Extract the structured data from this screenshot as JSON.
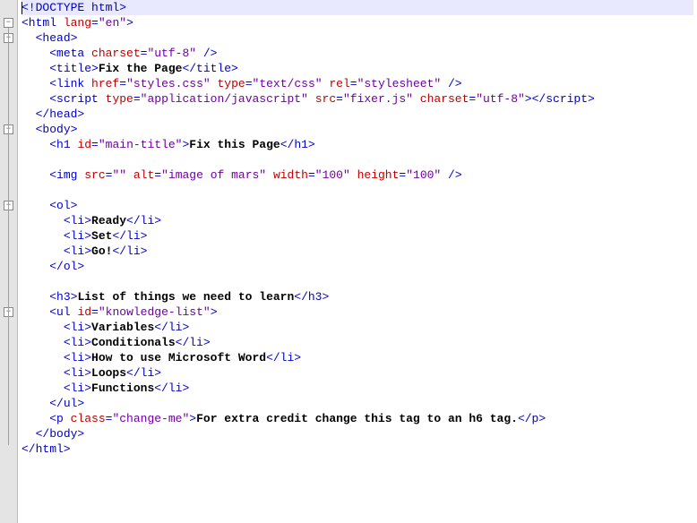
{
  "lines": [
    {
      "indent": 0,
      "fold": false,
      "hl": true,
      "caret": "start",
      "tokens": [
        {
          "t": "tag",
          "v": "<!DOCTYPE html>"
        }
      ]
    },
    {
      "indent": 0,
      "fold": true,
      "tokens": [
        {
          "t": "tag",
          "v": "<html "
        },
        {
          "t": "attr",
          "v": "lang"
        },
        {
          "t": "tag",
          "v": "="
        },
        {
          "t": "val",
          "v": "\"en\""
        },
        {
          "t": "tag",
          "v": ">"
        }
      ]
    },
    {
      "indent": 1,
      "fold": true,
      "tokens": [
        {
          "t": "tag",
          "v": "<head>"
        }
      ]
    },
    {
      "indent": 2,
      "fold": false,
      "tokens": [
        {
          "t": "tag",
          "v": "<meta "
        },
        {
          "t": "attr",
          "v": "charset"
        },
        {
          "t": "tag",
          "v": "="
        },
        {
          "t": "val",
          "v": "\"utf-8\""
        },
        {
          "t": "tag",
          "v": " />"
        }
      ]
    },
    {
      "indent": 2,
      "fold": false,
      "tokens": [
        {
          "t": "tag",
          "v": "<title>"
        },
        {
          "t": "txt",
          "v": "Fix the Page"
        },
        {
          "t": "tag",
          "v": "</title>"
        }
      ]
    },
    {
      "indent": 2,
      "fold": false,
      "tokens": [
        {
          "t": "tag",
          "v": "<link "
        },
        {
          "t": "attr",
          "v": "href"
        },
        {
          "t": "tag",
          "v": "="
        },
        {
          "t": "val",
          "v": "\"styles.css\""
        },
        {
          "t": "tag",
          "v": " "
        },
        {
          "t": "attr",
          "v": "type"
        },
        {
          "t": "tag",
          "v": "="
        },
        {
          "t": "val",
          "v": "\"text/css\""
        },
        {
          "t": "tag",
          "v": " "
        },
        {
          "t": "attr",
          "v": "rel"
        },
        {
          "t": "tag",
          "v": "="
        },
        {
          "t": "val",
          "v": "\"stylesheet\""
        },
        {
          "t": "tag",
          "v": " />"
        }
      ]
    },
    {
      "indent": 2,
      "fold": false,
      "tokens": [
        {
          "t": "tag",
          "v": "<script "
        },
        {
          "t": "attr",
          "v": "type"
        },
        {
          "t": "tag",
          "v": "="
        },
        {
          "t": "val",
          "v": "\"application/javascript\""
        },
        {
          "t": "tag",
          "v": " "
        },
        {
          "t": "attr",
          "v": "src"
        },
        {
          "t": "tag",
          "v": "="
        },
        {
          "t": "val",
          "v": "\"fixer.js\""
        },
        {
          "t": "tag",
          "v": " "
        },
        {
          "t": "attr",
          "v": "charset"
        },
        {
          "t": "tag",
          "v": "="
        },
        {
          "t": "val",
          "v": "\"utf-8\""
        },
        {
          "t": "tag",
          "v": ">"
        },
        {
          "t": "tag",
          "v": "</script>"
        }
      ]
    },
    {
      "indent": 1,
      "fold": false,
      "tokens": [
        {
          "t": "tag",
          "v": "</head>"
        }
      ]
    },
    {
      "indent": 1,
      "fold": true,
      "tokens": [
        {
          "t": "tag",
          "v": "<body>"
        }
      ]
    },
    {
      "indent": 2,
      "fold": false,
      "tokens": [
        {
          "t": "tag",
          "v": "<h1 "
        },
        {
          "t": "attr",
          "v": "id"
        },
        {
          "t": "tag",
          "v": "="
        },
        {
          "t": "val",
          "v": "\"main-title\""
        },
        {
          "t": "tag",
          "v": ">"
        },
        {
          "t": "txt",
          "v": "Fix this Page"
        },
        {
          "t": "tag",
          "v": "</h1>"
        }
      ]
    },
    {
      "indent": 0,
      "fold": false,
      "blank": true,
      "tokens": []
    },
    {
      "indent": 2,
      "fold": false,
      "tokens": [
        {
          "t": "tag",
          "v": "<img "
        },
        {
          "t": "attr",
          "v": "src"
        },
        {
          "t": "tag",
          "v": "="
        },
        {
          "t": "val",
          "v": "\"\""
        },
        {
          "t": "tag",
          "v": " "
        },
        {
          "t": "attr",
          "v": "alt"
        },
        {
          "t": "tag",
          "v": "="
        },
        {
          "t": "val",
          "v": "\"image of mars\""
        },
        {
          "t": "tag",
          "v": " "
        },
        {
          "t": "attr",
          "v": "width"
        },
        {
          "t": "tag",
          "v": "="
        },
        {
          "t": "val",
          "v": "\"100\""
        },
        {
          "t": "tag",
          "v": " "
        },
        {
          "t": "attr",
          "v": "height"
        },
        {
          "t": "tag",
          "v": "="
        },
        {
          "t": "val",
          "v": "\"100\""
        },
        {
          "t": "tag",
          "v": " />"
        }
      ]
    },
    {
      "indent": 0,
      "fold": false,
      "blank": true,
      "tokens": []
    },
    {
      "indent": 2,
      "fold": true,
      "tokens": [
        {
          "t": "tag",
          "v": "<ol>"
        }
      ]
    },
    {
      "indent": 3,
      "fold": false,
      "tokens": [
        {
          "t": "tag",
          "v": "<li>"
        },
        {
          "t": "txt",
          "v": "Ready"
        },
        {
          "t": "tag",
          "v": "</li>"
        }
      ]
    },
    {
      "indent": 3,
      "fold": false,
      "tokens": [
        {
          "t": "tag",
          "v": "<li>"
        },
        {
          "t": "txt",
          "v": "Set"
        },
        {
          "t": "tag",
          "v": "</li>"
        }
      ]
    },
    {
      "indent": 3,
      "fold": false,
      "tokens": [
        {
          "t": "tag",
          "v": "<li>"
        },
        {
          "t": "txt",
          "v": "Go!"
        },
        {
          "t": "tag",
          "v": "</li>"
        }
      ]
    },
    {
      "indent": 2,
      "fold": false,
      "tokens": [
        {
          "t": "tag",
          "v": "</ol>"
        }
      ]
    },
    {
      "indent": 0,
      "fold": false,
      "blank": true,
      "tokens": []
    },
    {
      "indent": 2,
      "fold": false,
      "tokens": [
        {
          "t": "tag",
          "v": "<h3>"
        },
        {
          "t": "txt",
          "v": "List of things we need to learn"
        },
        {
          "t": "tag",
          "v": "</h3>"
        }
      ]
    },
    {
      "indent": 2,
      "fold": true,
      "tokens": [
        {
          "t": "tag",
          "v": "<ul "
        },
        {
          "t": "attr",
          "v": "id"
        },
        {
          "t": "tag",
          "v": "="
        },
        {
          "t": "val",
          "v": "\"knowledge-list\""
        },
        {
          "t": "tag",
          "v": ">"
        }
      ]
    },
    {
      "indent": 3,
      "fold": false,
      "tokens": [
        {
          "t": "tag",
          "v": "<li>"
        },
        {
          "t": "txt",
          "v": "Variables"
        },
        {
          "t": "tag",
          "v": "</li>"
        }
      ]
    },
    {
      "indent": 3,
      "fold": false,
      "tokens": [
        {
          "t": "tag",
          "v": "<li>"
        },
        {
          "t": "txt",
          "v": "Conditionals"
        },
        {
          "t": "tag",
          "v": "</li>"
        }
      ]
    },
    {
      "indent": 3,
      "fold": false,
      "tokens": [
        {
          "t": "tag",
          "v": "<li>"
        },
        {
          "t": "txt",
          "v": "How to use Microsoft Word"
        },
        {
          "t": "tag",
          "v": "</li>"
        }
      ]
    },
    {
      "indent": 3,
      "fold": false,
      "tokens": [
        {
          "t": "tag",
          "v": "<li>"
        },
        {
          "t": "txt",
          "v": "Loops"
        },
        {
          "t": "tag",
          "v": "</li>"
        }
      ]
    },
    {
      "indent": 3,
      "fold": false,
      "tokens": [
        {
          "t": "tag",
          "v": "<li>"
        },
        {
          "t": "txt",
          "v": "Functions"
        },
        {
          "t": "tag",
          "v": "</li>"
        }
      ]
    },
    {
      "indent": 2,
      "fold": false,
      "tokens": [
        {
          "t": "tag",
          "v": "</ul>"
        }
      ]
    },
    {
      "indent": 2,
      "fold": false,
      "tokens": [
        {
          "t": "tag",
          "v": "<p "
        },
        {
          "t": "attr",
          "v": "class"
        },
        {
          "t": "tag",
          "v": "="
        },
        {
          "t": "val",
          "v": "\"change-me\""
        },
        {
          "t": "tag",
          "v": ">"
        },
        {
          "t": "txt",
          "v": "For extra credit change this tag to an h6 tag."
        },
        {
          "t": "tag",
          "v": "</p>"
        }
      ]
    },
    {
      "indent": 1,
      "fold": false,
      "tokens": [
        {
          "t": "tag",
          "v": "</body>"
        }
      ]
    },
    {
      "indent": 0,
      "fold": false,
      "tokens": [
        {
          "t": "tag",
          "v": "</html>"
        }
      ]
    }
  ],
  "indentString": "  ",
  "lineHeight": 17
}
